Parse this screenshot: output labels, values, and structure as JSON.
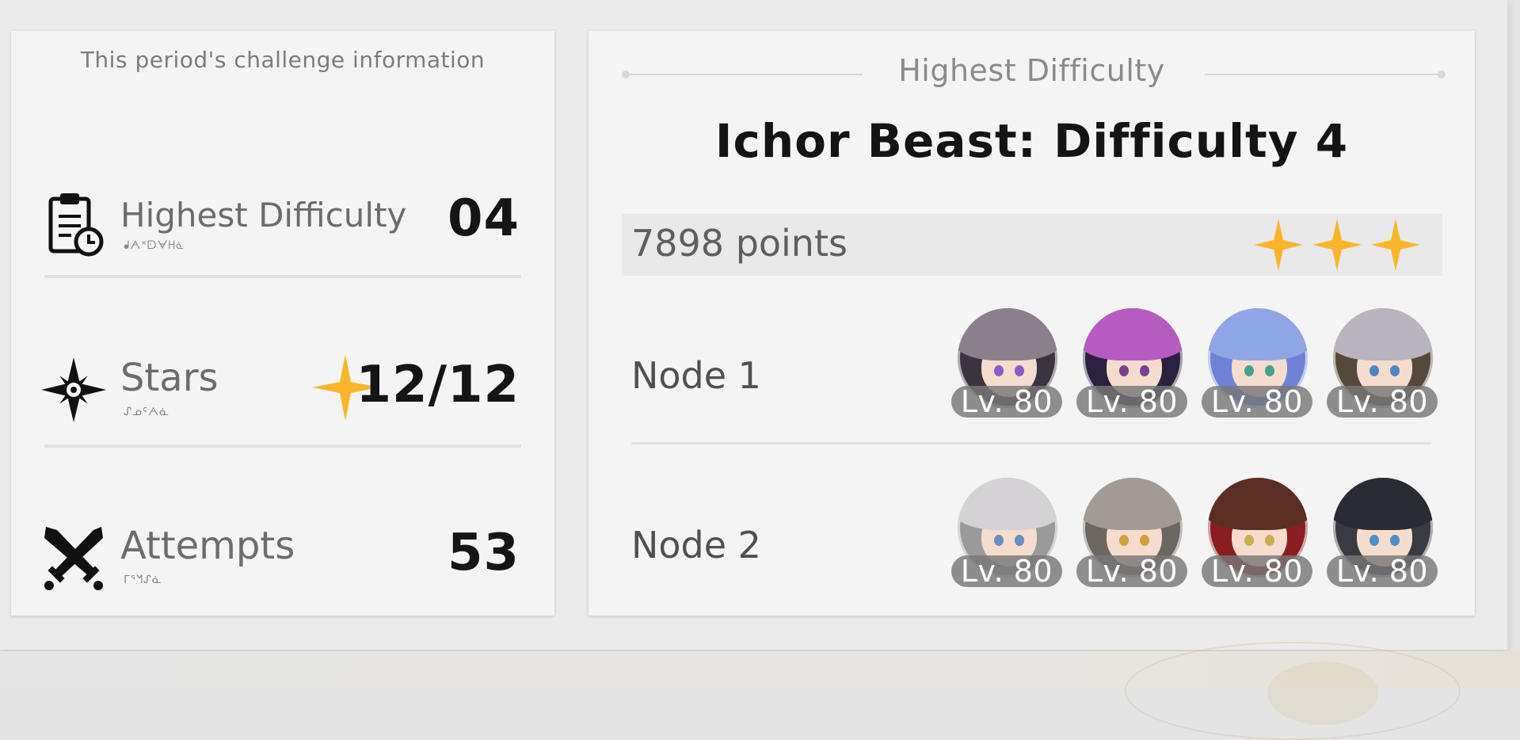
{
  "left_panel": {
    "title": "This period's challenge information",
    "stats": [
      {
        "icon": "clipboard-clock-icon",
        "label": "Highest Difficulty",
        "sub": "ᖱᗅᕽᗟᗄᕼᓈ",
        "value": "04"
      },
      {
        "icon": "compass-star-icon",
        "label": "Stars",
        "sub": "ᔑᓄᑦᗅᓈ",
        "value": "12/12"
      },
      {
        "icon": "crossed-swords-icon",
        "label": "Attempts",
        "sub": "ᒥᕐᖿᔑᓈ",
        "value": "53"
      }
    ]
  },
  "right_panel": {
    "header": "Highest Difficulty",
    "title": "Ichor Beast: Difficulty 4",
    "score": "7898 points",
    "stars_earned": 3,
    "nodes": [
      {
        "label": "Node 1",
        "characters": [
          {
            "level": "Lv. 80",
            "hair": "#8c7f8c",
            "eye": "#8a5cc9",
            "bg": "#3b3440"
          },
          {
            "level": "Lv. 80",
            "hair": "#b65bbf",
            "eye": "#7a3f8f",
            "bg": "#2a2140"
          },
          {
            "level": "Lv. 80",
            "hair": "#8fa6e6",
            "eye": "#43a38f",
            "bg": "#6d82d6"
          },
          {
            "level": "Lv. 80",
            "hair": "#b9b4c0",
            "eye": "#4d86c7",
            "bg": "#57493a"
          }
        ]
      },
      {
        "label": "Node 2",
        "characters": [
          {
            "level": "Lv. 80",
            "hair": "#d4d2d5",
            "eye": "#6b8cc4",
            "bg": "#9a9a9a"
          },
          {
            "level": "Lv. 80",
            "hair": "#a49a95",
            "eye": "#d1a23a",
            "bg": "#6d6762"
          },
          {
            "level": "Lv. 80",
            "hair": "#5a2f22",
            "eye": "#c9b04c",
            "bg": "#8a1e1e"
          },
          {
            "level": "Lv. 80",
            "hair": "#2b2b33",
            "eye": "#4f8fc9",
            "bg": "#3a3a42"
          }
        ]
      }
    ]
  },
  "colors": {
    "star": "#fbb52b",
    "value_text": "#151515",
    "card_bg": "#f4f4f4"
  }
}
